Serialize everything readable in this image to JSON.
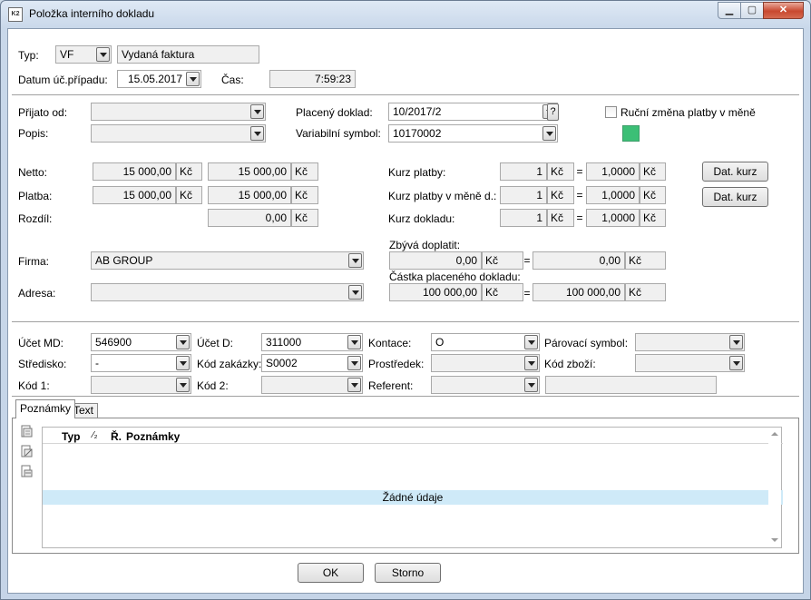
{
  "window": {
    "title": "Položka interního dokladu",
    "min": "▁",
    "max": "▢",
    "close": "✕"
  },
  "header": {
    "typ_label": "Typ:",
    "typ_value": "VF",
    "typ_desc": "Vydaná faktura",
    "datum_label": "Datum úč.případu:",
    "datum_value": "15.05.2017",
    "cas_label": "Čas:",
    "cas_value": "7:59:23"
  },
  "payment": {
    "prijato_label": "Přijato od:",
    "prijato_value": "",
    "popis_label": "Popis:",
    "popis_value": "",
    "placeny_label": "Placený doklad:",
    "placeny_value": "10/2017/2",
    "placeny_help": "?",
    "varsym_label": "Variabilní symbol:",
    "varsym_value": "10170002",
    "rucni_label": "Ruční změna platby v měně",
    "rucni_checked": false,
    "status_color": "#3cbf76"
  },
  "amounts": {
    "netto_label": "Netto:",
    "netto_1": "15 000,00",
    "netto_2": "15 000,00",
    "platba_label": "Platba:",
    "platba_1": "15 000,00",
    "platba_2": "15 000,00",
    "rozdil_label": "Rozdíl:",
    "rozdil_2": "0,00",
    "currency": "Kč"
  },
  "rates": {
    "kurz_platby_label": "Kurz platby:",
    "kurz_platby_qty": "1",
    "kurz_platby_rate": "1,0000",
    "kurz_mene_label": "Kurz platby v měně d.:",
    "kurz_mene_qty": "1",
    "kurz_mene_rate": "1,0000",
    "kurz_dokladu_label": "Kurz dokladu:",
    "kurz_dokladu_qty": "1",
    "kurz_dokladu_rate": "1,0000",
    "eq": "=",
    "dat_kurz_1": "Dat. kurz",
    "dat_kurz_2": "Dat. kurz"
  },
  "firma": {
    "firma_label": "Firma:",
    "firma_value": "AB GROUP",
    "adresa_label": "Adresa:",
    "adresa_value": "",
    "zbyva_label": "Zbývá doplatit:",
    "zbyva_1": "0,00",
    "zbyva_2": "0,00",
    "castka_label": "Částka placeného dokladu:",
    "castka_1": "100 000,00",
    "castka_2": "100 000,00"
  },
  "accounting": {
    "ucet_md_label": "Účet MD:",
    "ucet_md_value": "546900",
    "ucet_d_label": "Účet D:",
    "ucet_d_value": "311000",
    "kontace_label": "Kontace:",
    "kontace_value": "O",
    "parovaci_label": "Párovací symbol:",
    "parovaci_value": "",
    "stredisko_label": "Středisko:",
    "stredisko_value": "-",
    "zakazka_label": "Kód zakázky:",
    "zakazka_value": "S0002",
    "prostredek_label": "Prostředek:",
    "prostredek_value": "",
    "kod_zbozi_label": "Kód zboží:",
    "kod_zbozi_value": "",
    "kod1_label": "Kód 1:",
    "kod1_value": "",
    "kod2_label": "Kód 2:",
    "kod2_value": "",
    "referent_label": "Referent:",
    "referent_value": "",
    "referent_desc": ""
  },
  "tabs": {
    "poznamky": "Poznámky",
    "text": "Text"
  },
  "notes_grid": {
    "col_typ": "Typ",
    "col_sort": "⁄₂",
    "col_r": "Ř.",
    "col_poznamky": "Poznámky",
    "empty": "Žádné údaje"
  },
  "footer": {
    "ok": "OK",
    "storno": "Storno"
  }
}
